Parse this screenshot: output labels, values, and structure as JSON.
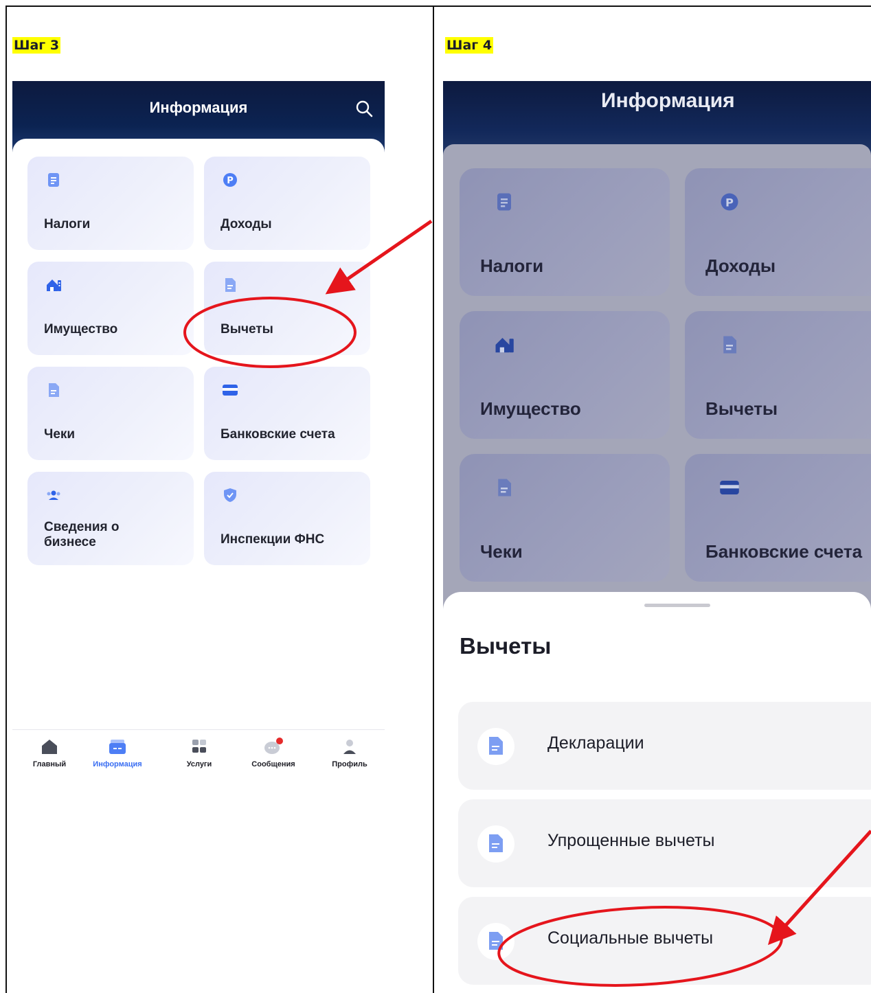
{
  "steps": {
    "left_label": "Шаг 3",
    "right_label": "Шаг 4"
  },
  "screen_left": {
    "header_title": "Информация",
    "tiles": [
      {
        "label": "Налоги",
        "icon": "document-icon"
      },
      {
        "label": "Доходы",
        "icon": "ruble-coin-icon"
      },
      {
        "label": "Имущество",
        "icon": "house-icon"
      },
      {
        "label": "Вычеты",
        "icon": "document-icon"
      },
      {
        "label": "Чеки",
        "icon": "receipt-icon"
      },
      {
        "label": "Банковские счета",
        "icon": "bank-card-icon"
      },
      {
        "label": "Сведения о бизнесе",
        "line1": "Сведения о",
        "line2": "бизнесе",
        "icon": "people-group-icon"
      },
      {
        "label": "Инспекции ФНС",
        "icon": "shield-check-icon"
      }
    ],
    "nav": [
      {
        "label": "Главный",
        "icon": "home-icon",
        "active": false
      },
      {
        "label": "Информация",
        "icon": "folder-icon",
        "active": true
      },
      {
        "label": "Услуги",
        "icon": "grid-icon",
        "active": false
      },
      {
        "label": "Сообщения",
        "icon": "chat-bubble-icon",
        "active": false,
        "badge": true
      },
      {
        "label": "Профиль",
        "icon": "person-icon",
        "active": false
      }
    ]
  },
  "screen_right": {
    "header_title": "Информация",
    "tiles": [
      {
        "label": "Налоги"
      },
      {
        "label": "Доходы"
      },
      {
        "label": "Имущество"
      },
      {
        "label": "Вычеты"
      },
      {
        "label": "Чеки"
      },
      {
        "label": "Банковские счета"
      }
    ],
    "sheet_title": "Вычеты",
    "rows": [
      {
        "label": "Декларации"
      },
      {
        "label": "Упрощенные вычеты"
      },
      {
        "label": "Социальные вычеты"
      }
    ]
  },
  "colors": {
    "accent_blue": "#3a6ef2",
    "header_navy": "#0d1a3f",
    "annotation_red": "#e5151c",
    "step_highlight": "#ffff00",
    "badge_red": "#e52b2b"
  }
}
